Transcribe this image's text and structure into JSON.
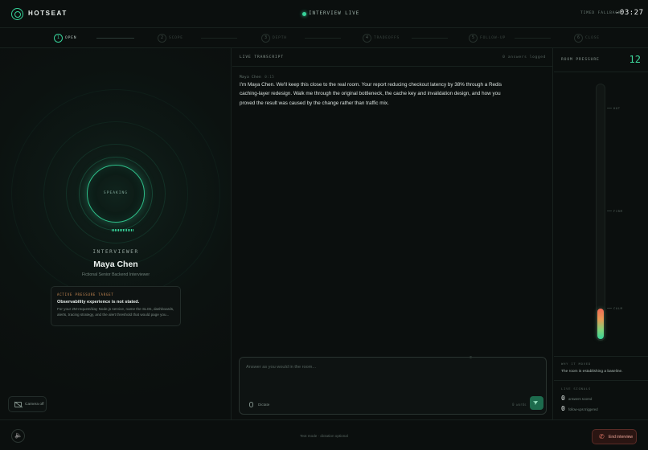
{
  "header": {
    "logo_text": "HOTSEAT",
    "status": "INTERVIEW LIVE",
    "timer_label": "TIMED FALLBACK",
    "timer_value": "-03:27"
  },
  "stepper": {
    "steps": [
      {
        "num": "1",
        "label": "OPEN"
      },
      {
        "num": "2",
        "label": "SCOPE"
      },
      {
        "num": "3",
        "label": "DEPTH"
      },
      {
        "num": "4",
        "label": "TRADEOFFS"
      },
      {
        "num": "5",
        "label": "FOLLOW-UP"
      },
      {
        "num": "6",
        "label": "CLOSE"
      }
    ],
    "active_step": 1
  },
  "interviewer": {
    "speaking_label": "SPEAKING",
    "role_label": "INTERVIEWER",
    "name": "Maya Chen",
    "persona": "Fictional Senior Backend Interviewer"
  },
  "pressure_target": {
    "tag": "ACTIVE PRESSURE TARGET",
    "title": "Observability experience is not stated.",
    "description": "For your 2M-request/day Node.js service, name the SLOs, dashboards, alerts, tracing strategy, and the alert threshold that would page you..."
  },
  "camera": {
    "label": "Camera off"
  },
  "transcript": {
    "title": "LIVE TRANSCRIPT",
    "count": "0 answers logged",
    "messages": [
      {
        "speaker": "Maya Chen",
        "time": "0:15",
        "text": "I'm Maya Chen. We'll keep this close to the real room. Your report reducing checkout latency by 38% through a Redis caching-layer redesign. Walk me through the original bottleneck, the cache key and invalidation design, and how you proved the result was caused by the change rather than traffic mix."
      }
    ]
  },
  "answer": {
    "placeholder": "Answer as you would in the room...",
    "value": "",
    "dictate_label": "Dictate",
    "word_count": "0 words"
  },
  "room_pressure": {
    "title": "ROOM PRESSURE",
    "value": "12",
    "level": 0.12,
    "ticks": [
      "HOT",
      "FIRM",
      "CALM"
    ]
  },
  "why_it_moved": {
    "title": "WHY IT MOVED",
    "text": "The room is establishing a baseline."
  },
  "live_signals": {
    "title": "LIVE SIGNALS",
    "rows": [
      {
        "value": "0",
        "label": "answers scored"
      },
      {
        "value": "0",
        "label": "follow-ups triggered"
      }
    ]
  },
  "footer": {
    "note": "Text mode · dictation optional",
    "end_label": "End interview"
  },
  "colors": {
    "accent": "#37d39a",
    "background": "#0b0f0e",
    "danger": "#e97a6a"
  }
}
